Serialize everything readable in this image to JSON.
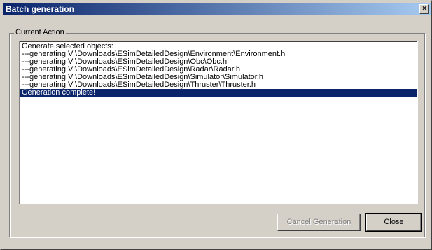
{
  "window": {
    "title": "Batch generation",
    "close_glyph": "×"
  },
  "group": {
    "legend": "Current Action"
  },
  "log": {
    "lines": [
      "Generate selected objects:",
      "---generating V:\\Downloads\\ESimDetailedDesign\\Environment\\Environment.h",
      "---generating V:\\Downloads\\ESimDetailedDesign\\Obc\\Obc.h",
      "---generating V:\\Downloads\\ESimDetailedDesign\\Radar\\Radar.h",
      "---generating V:\\Downloads\\ESimDetailedDesign\\Simulator\\Simulator.h",
      "---generating V:\\Downloads\\ESimDetailedDesign\\Thruster\\Thruster.h",
      "Generation complete!"
    ],
    "selected_index": 6
  },
  "buttons": {
    "cancel_label": "Cancel Generation",
    "close_label_mnemonic": "C",
    "close_label_rest": "lose"
  },
  "colors": {
    "titlebar_start": "#0a246a",
    "titlebar_end": "#a6caf0",
    "selection": "#0a246a",
    "face": "#d4d0c8"
  }
}
